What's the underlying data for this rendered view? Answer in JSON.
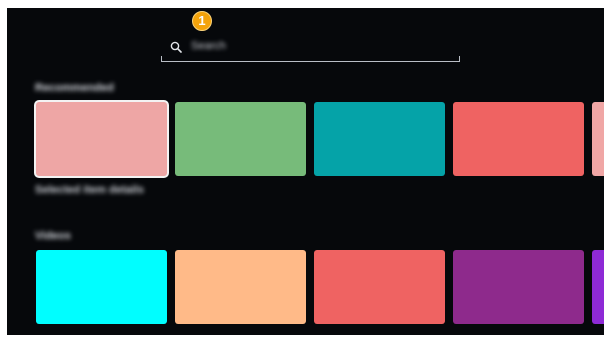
{
  "search": {
    "placeholder": "Search",
    "badge_number": "1"
  },
  "rows": [
    {
      "title": "Recommended",
      "tiles": [
        {
          "color": "#eea6a5",
          "selected": true
        },
        {
          "color": "#77bb7a"
        },
        {
          "color": "#05a3a8"
        },
        {
          "color": "#ef6362"
        },
        {
          "color": "#f0a6a5"
        }
      ]
    },
    {
      "title": "Videos",
      "tiles": [
        {
          "color": "#00feff"
        },
        {
          "color": "#ffba88"
        },
        {
          "color": "#ef6362"
        },
        {
          "color": "#8e2a8c"
        },
        {
          "color": "#8e2ad6"
        }
      ]
    }
  ],
  "caption": "Selected item details"
}
